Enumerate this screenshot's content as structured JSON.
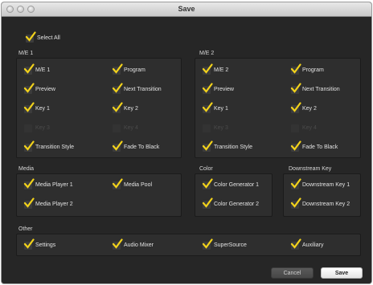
{
  "window": {
    "title": "Save"
  },
  "select_all": {
    "label": "Select All",
    "checked": true
  },
  "sections": {
    "me1": {
      "title": "M/E 1"
    },
    "me2": {
      "title": "M/E 2"
    },
    "media": {
      "title": "Media"
    },
    "color": {
      "title": "Color"
    },
    "dsk": {
      "title": "Downstream Key"
    },
    "other": {
      "title": "Other"
    }
  },
  "items": {
    "me1": [
      "M/E 1",
      "Program",
      "Preview",
      "Next Transition",
      "Key 1",
      "Key 2",
      "Key 3",
      "Key 4",
      "Transition Style",
      "Fade To Black"
    ],
    "me2": [
      "M/E 2",
      "Program",
      "Preview",
      "Next Transition",
      "Key 1",
      "Key 2",
      "Key 3",
      "Key 4",
      "Transition Style",
      "Fade To Black"
    ],
    "media": [
      "Media Player 1",
      "Media Pool",
      "Media Player 2"
    ],
    "color": [
      "Color Generator 1",
      "Color Generator 2"
    ],
    "dsk": [
      "Downstream Key 1",
      "Downstream Key 2"
    ],
    "other": [
      "Settings",
      "Audio Mixer",
      "SuperSource",
      "Auxiliary"
    ]
  },
  "buttons": {
    "cancel": "Cancel",
    "save": "Save"
  },
  "colors": {
    "check": "#f2d21b",
    "background": "#262626",
    "panel": "#2e2e2e"
  }
}
